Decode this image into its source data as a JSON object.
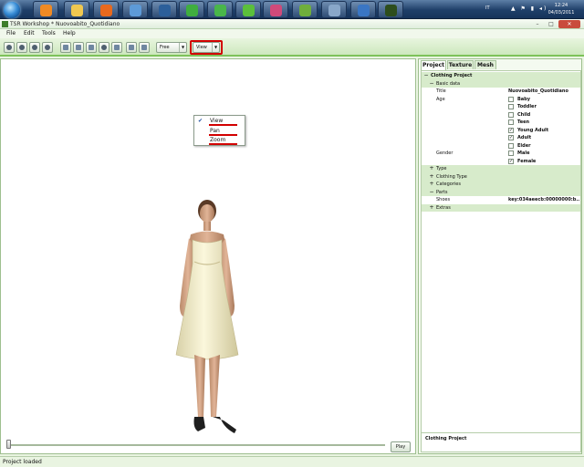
{
  "taskbar": {
    "language": "IT",
    "time": "12:24",
    "date": "04/03/2011",
    "apps": [
      {
        "icon": "media-player-icon",
        "color": "#f08a24"
      },
      {
        "icon": "folder-icon",
        "color": "#f0c850"
      },
      {
        "icon": "firefox-icon",
        "color": "#e8691e"
      },
      {
        "icon": "globe-icon",
        "color": "#5d9ad8"
      },
      {
        "icon": "photoshop-icon",
        "color": "#2c5f9a"
      },
      {
        "icon": "sims-icon",
        "color": "#3fae3f"
      },
      {
        "icon": "sims-icon",
        "color": "#49b64a"
      },
      {
        "icon": "sims-icon",
        "color": "#5bbf3b"
      },
      {
        "icon": "plumbob-icon",
        "color": "#d04a7a"
      },
      {
        "icon": "users-icon",
        "color": "#6fae3c"
      },
      {
        "icon": "disc-icon",
        "color": "#89a7c9"
      },
      {
        "icon": "explorer-icon",
        "color": "#3a76c4"
      },
      {
        "icon": "tsr-workshop-icon",
        "color": "#2d4d1d"
      }
    ]
  },
  "window": {
    "title": "TSR Workshop * Nuovoabito_Quotidiano",
    "minimize": "–",
    "maximize": "□",
    "close": "✕"
  },
  "menu": {
    "items": [
      "File",
      "Edit",
      "Tools",
      "Help"
    ]
  },
  "toolbar": {
    "camera_mode": "Free",
    "view_mode": "View",
    "accent": "#7dc25a"
  },
  "view_menu": {
    "items": [
      "View",
      "Pan",
      "Zoom"
    ],
    "checked": "View",
    "highlight_color": "#d20000"
  },
  "tabs": [
    "Project",
    "Texture",
    "Mesh"
  ],
  "active_tab": "Project",
  "tree": {
    "root": "Clothing Project",
    "basic_data": "Basic data",
    "title_label": "Title",
    "title_value": "Nuovoabito_Quotidiano",
    "age_label": "Age",
    "ages": [
      {
        "label": "Baby",
        "checked": false
      },
      {
        "label": "Toddler",
        "checked": false
      },
      {
        "label": "Child",
        "checked": false
      },
      {
        "label": "Teen",
        "checked": false
      },
      {
        "label": "Young Adult",
        "checked": true
      },
      {
        "label": "Adult",
        "checked": true
      },
      {
        "label": "Elder",
        "checked": false
      }
    ],
    "gender_label": "Gender",
    "genders": [
      {
        "label": "Male",
        "checked": false
      },
      {
        "label": "Female",
        "checked": true
      }
    ],
    "type": "Type",
    "clothing_type": "Clothing Type",
    "categories": "Categories",
    "parts": "Parts",
    "shoes_label": "Shoes",
    "shoes_value": "key:034aeecb:00000000:b...",
    "extras": "Extras"
  },
  "info": {
    "title": "Clothing Project"
  },
  "playback": {
    "play_label": "Play",
    "position": 0
  },
  "status": {
    "text": "Project loaded"
  }
}
